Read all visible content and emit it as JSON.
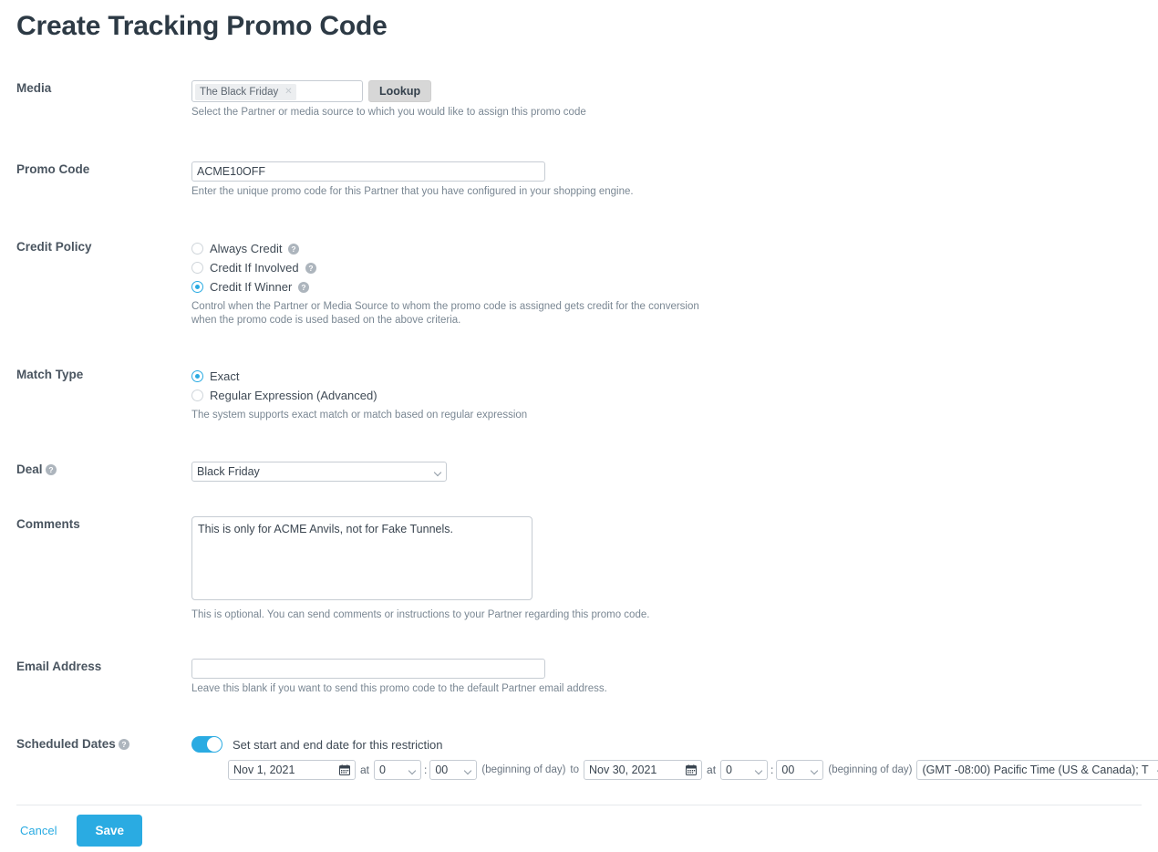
{
  "page": {
    "title": "Create Tracking Promo Code"
  },
  "media": {
    "label": "Media",
    "chip_value": "The Black Friday",
    "chip_remove_icon": "close-x-icon",
    "lookup_label": "Lookup",
    "hint": "Select the Partner or media source to which you would like to assign this promo code"
  },
  "promo_code": {
    "label": "Promo Code",
    "value": "ACME10OFF",
    "hint": "Enter the unique promo code for this Partner that you have configured in your shopping engine."
  },
  "credit_policy": {
    "label": "Credit Policy",
    "options": [
      {
        "label": "Always Credit",
        "selected": false,
        "help_icon": "question-mark-icon"
      },
      {
        "label": "Credit If Involved",
        "selected": false,
        "help_icon": "question-mark-icon"
      },
      {
        "label": "Credit If Winner",
        "selected": true,
        "help_icon": "question-mark-icon"
      }
    ],
    "hint": "Control when the Partner or Media Source to whom the promo code is assigned gets credit for the conversion when the promo code is used based on the above criteria."
  },
  "match_type": {
    "label": "Match Type",
    "options": [
      {
        "label": "Exact",
        "selected": true
      },
      {
        "label": "Regular Expression (Advanced)",
        "selected": false
      }
    ],
    "hint": "The system supports exact match or match based on regular expression"
  },
  "deal": {
    "label": "Deal",
    "help_icon": "question-mark-icon",
    "value": "Black Friday"
  },
  "comments": {
    "label": "Comments",
    "value": "This is only for ACME Anvils, not for Fake Tunnels.",
    "hint": "This is optional. You can send comments or instructions to your Partner regarding this promo code."
  },
  "email_address": {
    "label": "Email Address",
    "value": "",
    "placeholder": "",
    "hint": "Leave this blank if you want to send this promo code to the default Partner email address."
  },
  "scheduled_dates": {
    "label": "Scheduled Dates",
    "help_icon": "question-mark-icon",
    "toggle_on": true,
    "toggle_label": "Set start and end date for this restriction",
    "start": {
      "date": "Nov 1, 2021",
      "calendar_icon": "calendar-icon",
      "at_label": "at",
      "hour": "0",
      "colon": ":",
      "minute": "00",
      "note": "(beginning of day)"
    },
    "to_label": "to",
    "end": {
      "date": "Nov 30, 2021",
      "calendar_icon": "calendar-icon",
      "at_label": "at",
      "hour": "0",
      "colon": ":",
      "minute": "00",
      "note": "(beginning of day)"
    },
    "timezone": "(GMT -08:00) Pacific Time (US & Canada); T"
  },
  "footer": {
    "cancel_label": "Cancel",
    "save_label": "Save"
  },
  "colors": {
    "accent": "#2aabe2",
    "title": "#2d3a45",
    "label": "#4a5560",
    "hint": "#7a8793",
    "border": "#c6ccd3"
  }
}
